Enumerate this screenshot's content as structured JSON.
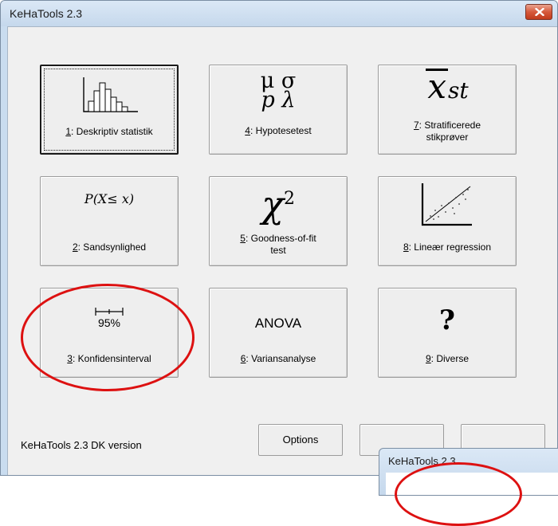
{
  "window": {
    "title": "KeHaTools 2.3",
    "close_icon": "close-x-icon"
  },
  "buttons": [
    {
      "key": "1",
      "text": ": Deskriptiv statistik",
      "icon": "histogram-icon",
      "selected": true
    },
    {
      "key": "4",
      "text": ": Hypotesetest",
      "icon": "greek-symbols-icon",
      "symbols": [
        "μ",
        "σ",
        "p",
        "λ"
      ]
    },
    {
      "key": "7",
      "text": ": Stratificerede",
      "text2": "stikprøver",
      "icon": "xbar-st-icon",
      "symbol": "x",
      "subscript": "st"
    },
    {
      "key": "2",
      "text": ": Sandsynlighed",
      "icon": "probability-formula-icon",
      "formula": "P(X≤ x)"
    },
    {
      "key": "5",
      "text": ": Goodness-of-fit",
      "text2": "test",
      "icon": "chi-square-icon",
      "symbol": "χ",
      "superscript": "2"
    },
    {
      "key": "8",
      "text": ": Lineær regression",
      "icon": "scatter-regression-icon"
    },
    {
      "key": "3",
      "text": ": Konfidensinterval",
      "icon": "interval-icon",
      "interval_label": "95%"
    },
    {
      "key": "6",
      "text": ": Variansanalyse",
      "icon": "anova-icon",
      "icon_text": "ANOVA"
    },
    {
      "key": "9",
      "text": ": Diverse",
      "icon": "question-mark-icon",
      "icon_text": "?"
    }
  ],
  "footer": {
    "options_label": "Options",
    "version_text": "KeHaTools 2.3  DK version"
  },
  "second_window": {
    "title": "KeHaTools 2.3"
  },
  "colors": {
    "annotation": "#dd1111",
    "close_button": "#c94a2c",
    "title_bar": "#c9dcef"
  }
}
